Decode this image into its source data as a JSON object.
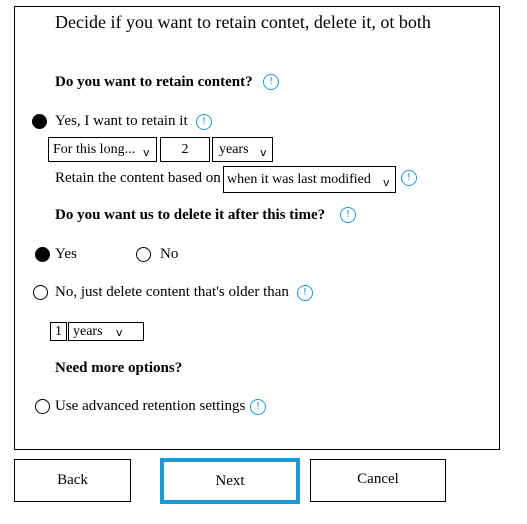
{
  "dialog": {
    "title": "Decide if you want to retain contet, delete it, ot both"
  },
  "retain": {
    "heading": "Do you want to retain content?",
    "yes_label": "Yes, I want to retain it",
    "period_select": "For this long...",
    "period_value": "2",
    "period_unit": "years",
    "based_on_label": "Retain the content based on",
    "based_on_select": "when it was last modified"
  },
  "delete_after": {
    "heading": "Do you want us to delete it after this time?",
    "yes_label": "Yes",
    "no_label": "No"
  },
  "delete_only": {
    "label": "No, just delete content that's older than",
    "value": "1",
    "unit": "years"
  },
  "more_options": {
    "heading": "Need more options?",
    "advanced_label": "Use advanced retention settings"
  },
  "footer": {
    "back_label": "Back",
    "next_label": "Next",
    "cancel_label": "Cancel"
  },
  "icons": {
    "info_glyph": "!",
    "chevron_glyph": "v"
  },
  "colors": {
    "accent": "#1a9ad6",
    "border": "#000000"
  }
}
